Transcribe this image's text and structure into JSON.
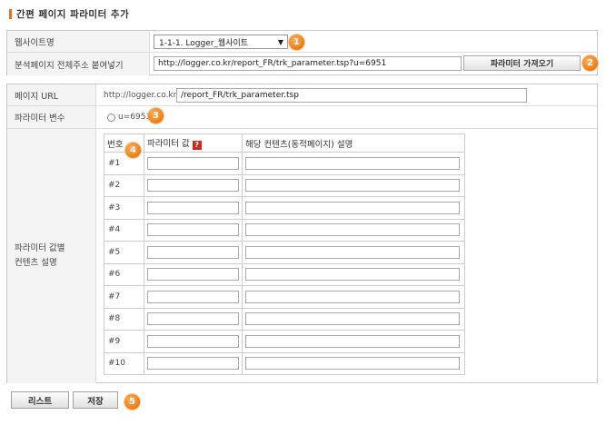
{
  "title": "간편 페이지 파라미터 추가",
  "colors": {
    "accent": "#e8701e",
    "badge": "#ee7a10",
    "help": "#cc2a1a"
  },
  "form1": {
    "site_label": "웹사이트명",
    "site_value": "1-1-1. Logger_웹사이트",
    "url_label": "분석페이지 전체주소 붙여넣기",
    "url_value": "http://logger.co.kr/report_FR/trk_parameter.tsp?u=6951",
    "fetch_button": "파라미터 가져오기"
  },
  "form2": {
    "page_url_label": "페이지 URL",
    "page_url_prefix": "http://logger.co.kr",
    "page_url_value": "/report_FR/trk_parameter.tsp",
    "param_var_label": "파라미터 변수",
    "param_var_option": "u=6951",
    "desc_label_line1": "파라미터 값별",
    "desc_label_line2": "컨텐츠 설명",
    "table": {
      "headers": [
        "번호",
        "파라미터 값",
        "해당 컨텐츠(동적페이지) 설명"
      ],
      "help_icon": "?",
      "rows": [
        "#1",
        "#2",
        "#3",
        "#4",
        "#5",
        "#6",
        "#7",
        "#8",
        "#9",
        "#10"
      ]
    }
  },
  "buttons": {
    "list": "리스트",
    "save": "저장"
  },
  "badges": [
    "1",
    "2",
    "3",
    "4",
    "5"
  ]
}
